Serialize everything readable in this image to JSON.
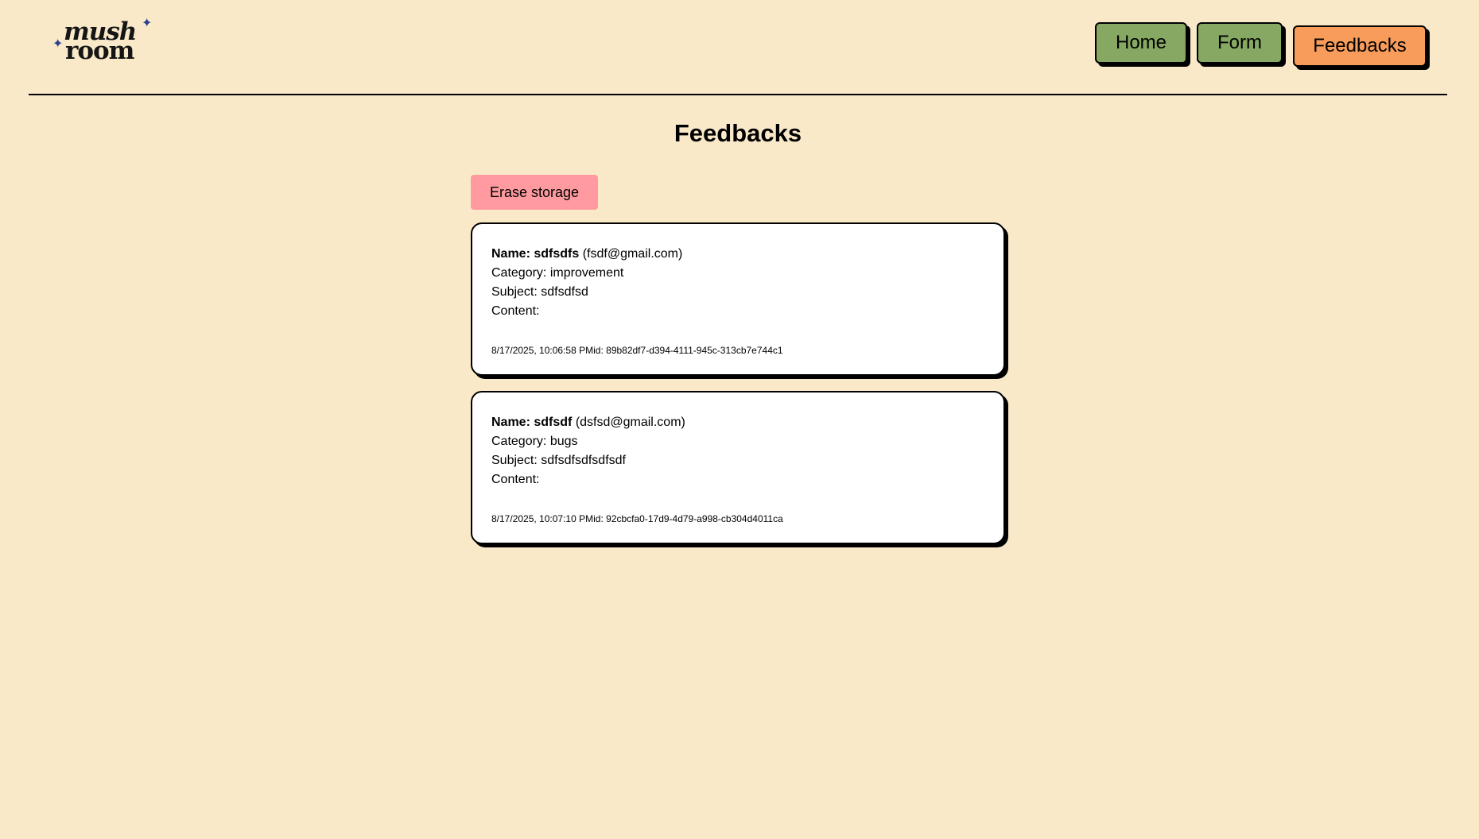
{
  "header": {
    "logo": {
      "line1": "mush",
      "line2": "room"
    },
    "nav": [
      {
        "label": "Home"
      },
      {
        "label": "Form"
      },
      {
        "label": "Feedbacks"
      }
    ]
  },
  "main": {
    "title": "Feedbacks",
    "erase_label": "Erase storage",
    "name_prefix": "Name:",
    "category_prefix": "Category:",
    "subject_prefix": "Subject:",
    "content_label": "Content:",
    "id_prefix": "id:",
    "feedbacks": [
      {
        "name": "sdfsdfs",
        "email": "(fsdf@gmail.com)",
        "category": "improvement",
        "subject": "sdfsdfsd",
        "content": "",
        "timestamp": "8/17/2025, 10:06:58 PM",
        "id": "89b82df7-d394-4111-945c-313cb7e744c1"
      },
      {
        "name": "sdfsdf",
        "email": "(dsfsd@gmail.com)",
        "category": "bugs",
        "subject": "sdfsdfsdfsdfsdf",
        "content": "",
        "timestamp": "8/17/2025, 10:07:10 PM",
        "id": "92cbcfa0-17d9-4d79-a998-cb304d4011ca"
      }
    ]
  },
  "colors": {
    "background": "#f9e9c9",
    "nav_default": "#86a862",
    "nav_active": "#f79c5a",
    "erase_button": "#ff9ba0",
    "logo_star": "#2b3f8f"
  }
}
